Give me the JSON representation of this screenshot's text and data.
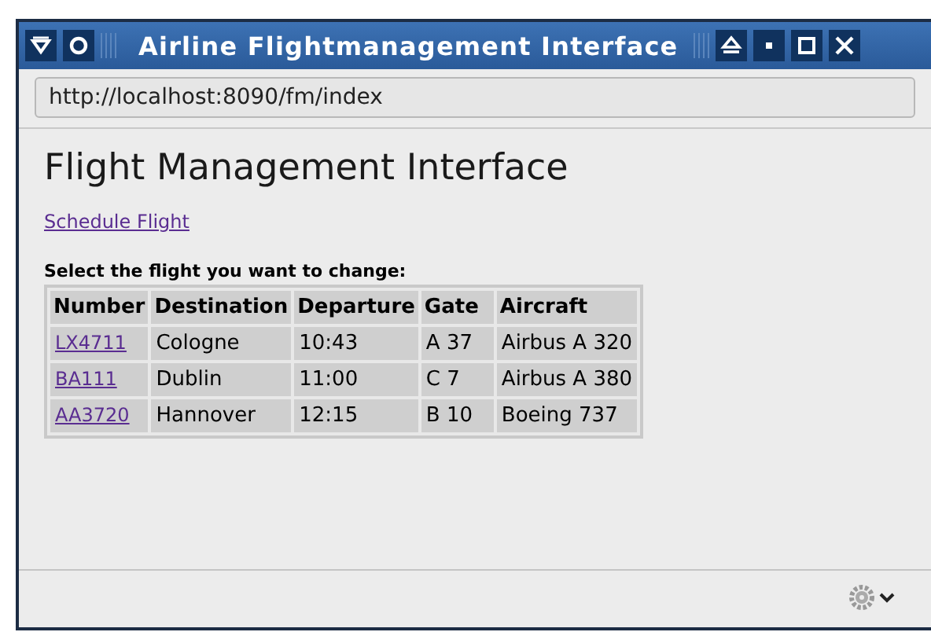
{
  "window": {
    "title": "Airline Flightmanagement Interface"
  },
  "address_bar": {
    "value": "http://localhost:8090/fm/index"
  },
  "page": {
    "heading": "Flight Management Interface",
    "schedule_link": "Schedule Flight",
    "table_caption": "Select the flight you want to change:",
    "table": {
      "columns": [
        "Number",
        "Destination",
        "Departure",
        "Gate",
        "Aircraft"
      ],
      "rows": [
        {
          "number": "LX4711",
          "destination": "Cologne",
          "departure": "10:43",
          "gate": "A 37",
          "aircraft": "Airbus A 320"
        },
        {
          "number": "BA111",
          "destination": "Dublin",
          "departure": "11:00",
          "gate": "C 7",
          "aircraft": "Airbus A 380"
        },
        {
          "number": "AA3720",
          "destination": "Hannover",
          "departure": "12:15",
          "gate": "B 10",
          "aircraft": "Boeing 737"
        }
      ]
    }
  }
}
